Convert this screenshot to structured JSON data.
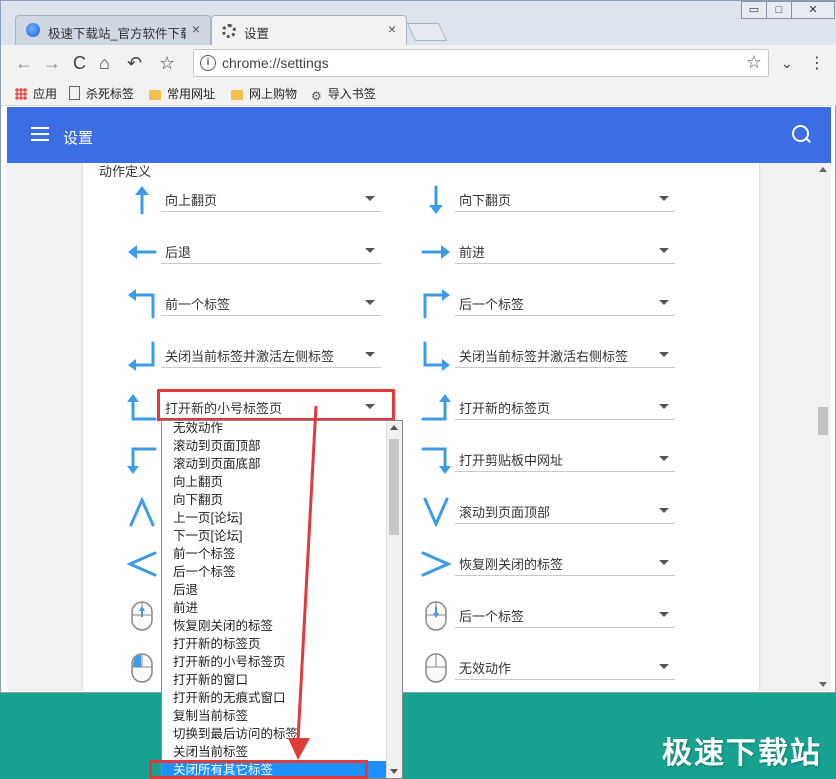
{
  "tabs": [
    {
      "title": "极速下载站_官方软件下载",
      "close": "×"
    },
    {
      "title": "设置",
      "close": "×"
    }
  ],
  "window_controls": [
    "▭",
    "□",
    "✕"
  ],
  "toolbar": {
    "url": "chrome://settings",
    "back": "←",
    "forward": "→",
    "reload": "C",
    "home": "⌂",
    "undo": "↶",
    "star": "☆"
  },
  "bookmarks": [
    {
      "label": "应用",
      "icon": "apps-grid-icon"
    },
    {
      "label": "杀死标签",
      "icon": "page-icon"
    },
    {
      "label": "常用网址",
      "icon": "folder-icon"
    },
    {
      "label": "网上购物",
      "icon": "folder-icon"
    },
    {
      "label": "导入书签",
      "icon": "gear-icon"
    }
  ],
  "header": {
    "title": "设置"
  },
  "section_title": "动作定义",
  "gestures": [
    {
      "left": {
        "icon": "arrow-up-icon",
        "value": "向上翻页"
      },
      "right": {
        "icon": "arrow-down-icon",
        "value": "向下翻页"
      }
    },
    {
      "left": {
        "icon": "arrow-left-icon",
        "value": "后退"
      },
      "right": {
        "icon": "arrow-right-icon",
        "value": "前进"
      }
    },
    {
      "left": {
        "icon": "arrow-up-left-icon",
        "value": "前一个标签"
      },
      "right": {
        "icon": "arrow-up-right-icon",
        "value": "后一个标签"
      }
    },
    {
      "left": {
        "icon": "arrow-down-left-icon",
        "value": "关闭当前标签并激活左侧标签"
      },
      "right": {
        "icon": "arrow-down-right-icon",
        "value": "关闭当前标签并激活右侧标签"
      }
    },
    {
      "left": {
        "icon": "arrow-left-up-icon",
        "value": "打开新的小号标签页"
      },
      "right": {
        "icon": "arrow-right-up-icon",
        "value": "打开新的标签页"
      }
    },
    {
      "left": {
        "icon": "arrow-left-down-icon",
        "value": ""
      },
      "right": {
        "icon": "arrow-right-down-icon",
        "value": "打开剪贴板中网址"
      }
    },
    {
      "left": {
        "icon": "caret-up-icon",
        "value": ""
      },
      "right": {
        "icon": "caret-down-icon",
        "value": "滚动到页面顶部"
      }
    },
    {
      "left": {
        "icon": "caret-left-icon",
        "value": ""
      },
      "right": {
        "icon": "caret-right-icon",
        "value": "恢复刚关闭的标签"
      }
    },
    {
      "left": {
        "icon": "mouse-scroll-up-icon",
        "value": ""
      },
      "right": {
        "icon": "mouse-scroll-down-icon",
        "value": "后一个标签"
      }
    },
    {
      "left": {
        "icon": "mouse-left-click-icon",
        "value": ""
      },
      "right": {
        "icon": "mouse-icon",
        "value": "无效动作"
      }
    }
  ],
  "dropdown_options": [
    "无效动作",
    "滚动到页面顶部",
    "滚动到页面底部",
    "向上翻页",
    "向下翻页",
    "上一页[论坛]",
    "下一页[论坛]",
    "前一个标签",
    "后一个标签",
    "后退",
    "前进",
    "恢复刚关闭的标签",
    "打开新的标签页",
    "打开新的小号标签页",
    "打开新的窗口",
    "打开新的无痕式窗口",
    "复制当前标签",
    "切换到最后访问的标签",
    "关闭当前标签",
    "关闭所有其它标签"
  ],
  "dropdown_selected": "关闭所有其它标签",
  "watermark": "极速下载站",
  "colors": {
    "accent": "#3b6ee2",
    "gesture_blue": "#3f9be6",
    "highlight_red": "#e03a3a",
    "select_highlight": "#1e90ff"
  }
}
